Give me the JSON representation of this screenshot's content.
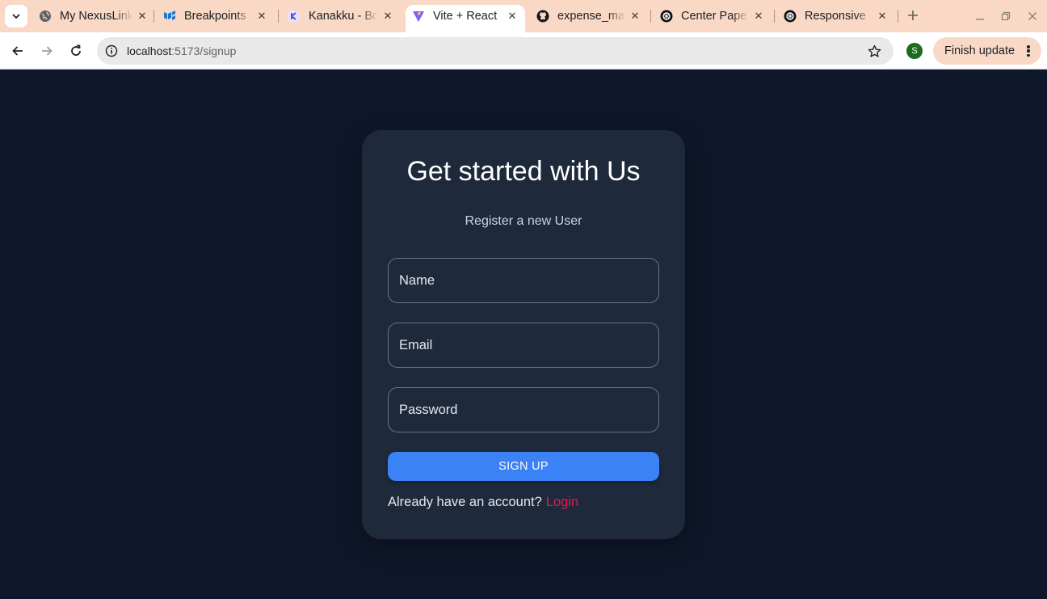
{
  "browser": {
    "tabs": [
      {
        "title": "My NexusLink",
        "favicon": "globe-icon",
        "active": false
      },
      {
        "title": "Breakpoints",
        "favicon": "mui-icon",
        "active": false
      },
      {
        "title": "Kanakku - Bo",
        "favicon": "kanakku-icon",
        "active": false
      },
      {
        "title": "Vite + React",
        "favicon": "vite-icon",
        "active": true
      },
      {
        "title": "expense_ma",
        "favicon": "github-icon",
        "active": false
      },
      {
        "title": "Center Pape",
        "favicon": "openai-icon",
        "active": false
      },
      {
        "title": "Responsive",
        "favicon": "openai-icon",
        "active": false
      }
    ],
    "address": {
      "host": "localhost",
      "path": ":5173/signup"
    },
    "profile_initial": "S",
    "update_button": "Finish update",
    "colors": {
      "frame": "#f9d8c6",
      "profile": "#1e6b1e"
    }
  },
  "page": {
    "title": "Get started with Us",
    "subtitle": "Register a new User",
    "fields": {
      "name_placeholder": "Name",
      "email_placeholder": "Email",
      "password_placeholder": "Password",
      "name_value": "",
      "email_value": "",
      "password_value": ""
    },
    "submit_label": "SIGN UP",
    "account_prompt": "Already have an account?",
    "login_link": "Login",
    "colors": {
      "background": "#0f172a",
      "card": "#1e293b",
      "primary": "#3b82f6",
      "link": "#e11d48"
    }
  }
}
